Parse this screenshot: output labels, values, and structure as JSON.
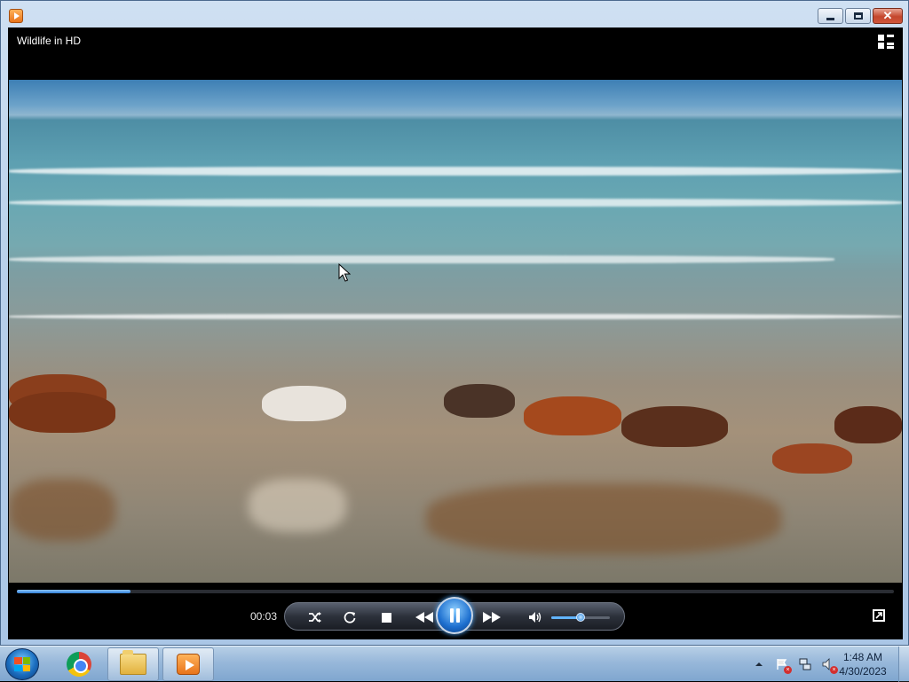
{
  "window": {
    "title_icon": "media-player-icon",
    "buttons": {
      "minimize": "minimize",
      "maximize": "maximize",
      "close": "close"
    }
  },
  "player": {
    "video_title": "Wildlife in HD",
    "switch_to_library_icon": "switch-to-library-icon",
    "elapsed_time": "00:03",
    "progress_fraction": 0.13,
    "volume_fraction": 0.5,
    "accent_color": "#2f7fd6",
    "controls": [
      "shuffle",
      "repeat",
      "stop",
      "previous",
      "pause",
      "next",
      "mute"
    ]
  },
  "taskbar": {
    "pinned": [
      "windows-start",
      "google-chrome",
      "windows-explorer",
      "windows-media-player"
    ],
    "clock_time": "1:48 AM",
    "clock_date": "4/30/2023",
    "tray_icons": [
      "show-hidden-icons",
      "action-center-warning",
      "network-disconnected",
      "volume-muted"
    ]
  }
}
